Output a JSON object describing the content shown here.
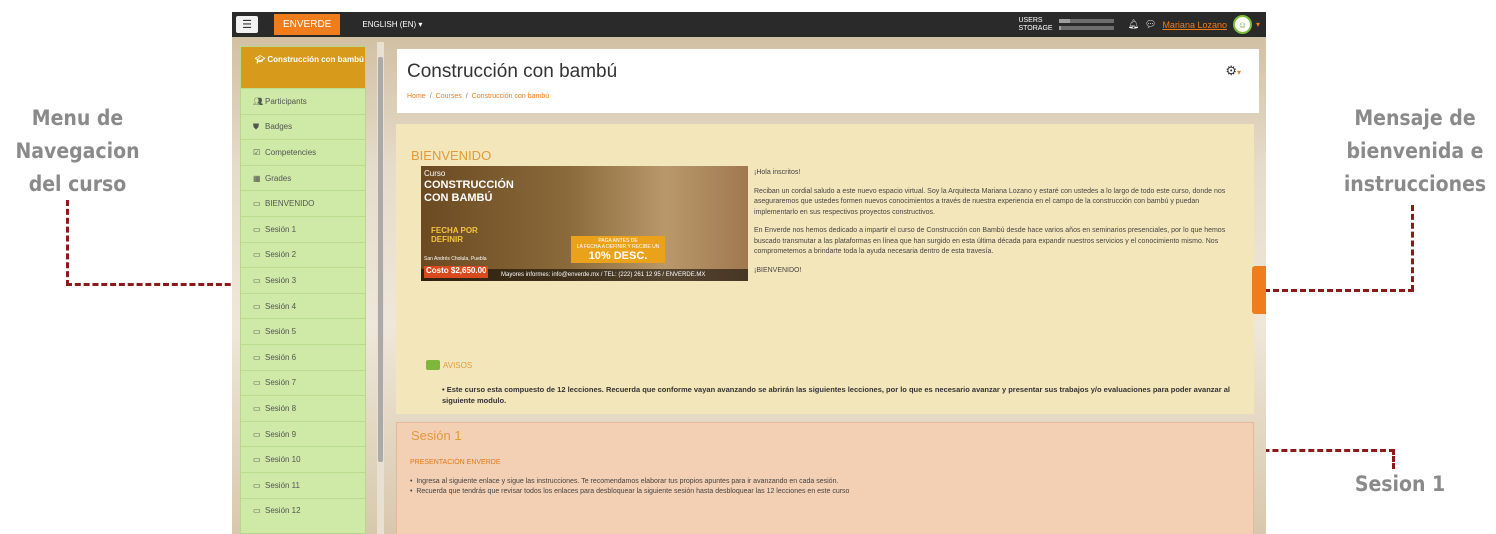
{
  "annotations": {
    "left": [
      "Menu de",
      "Navegacion",
      "del curso"
    ],
    "right": [
      "Mensaje de",
      "bienvenida e",
      "instrucciones"
    ],
    "bottom": "Sesion 1"
  },
  "navbar": {
    "brand": "ENVERDE",
    "language": "ENGLISH (EN)",
    "users_label": "USERS",
    "storage_label": "STORAGE",
    "user_name": "Mariana Lozano"
  },
  "sidebar": {
    "course": "Construcción con bambú",
    "items": [
      {
        "label": "Participants",
        "icon": "users-icon"
      },
      {
        "label": "Badges",
        "icon": "shield-icon"
      },
      {
        "label": "Competencies",
        "icon": "check-icon"
      },
      {
        "label": "Grades",
        "icon": "table-icon"
      },
      {
        "label": "BIENVENIDO",
        "icon": "folder-icon"
      },
      {
        "label": "Sesión 1",
        "icon": "folder-icon"
      },
      {
        "label": "Sesión 2",
        "icon": "folder-icon"
      },
      {
        "label": "Sesión 3",
        "icon": "folder-icon"
      },
      {
        "label": "Sesión 4",
        "icon": "folder-icon"
      },
      {
        "label": "Sesión 5",
        "icon": "folder-icon"
      },
      {
        "label": "Sesión 6",
        "icon": "folder-icon"
      },
      {
        "label": "Sesión 7",
        "icon": "folder-icon"
      },
      {
        "label": "Sesión 8",
        "icon": "folder-icon"
      },
      {
        "label": "Sesión 9",
        "icon": "folder-icon"
      },
      {
        "label": "Sesión 10",
        "icon": "folder-icon"
      },
      {
        "label": "Sesión 11",
        "icon": "folder-icon"
      },
      {
        "label": "Sesión 12",
        "icon": "folder-icon"
      }
    ]
  },
  "header": {
    "title": "Construcción con bambú",
    "breadcrumb": [
      "Home",
      "Courses",
      "Construcción con bambú"
    ]
  },
  "welcome": {
    "title": "BIENVENIDO",
    "banner": {
      "line1": "Curso",
      "line2": "CONSTRUCCIÓN",
      "line3": "CON BAMBÚ",
      "date1": "FECHA POR",
      "date2": "DEFINIR",
      "place": "San Andrés Cholula, Puebla",
      "price": "Costo $2,650.00",
      "promo1": "PAGA ANTES DE",
      "promo2": "LA FECHA A DEFINIR Y RECIBE UN",
      "promo3": "10% DESC.",
      "contact": "Mayores informes:  info@enverde.mx / TEL: (222) 261 12 95 / ENVERDE.MX"
    },
    "paragraphs": [
      "¡Hola inscritos!",
      "Reciban un cordial saludo a este nuevo espacio virtual. Soy la Arquitecta Mariana Lozano y estaré con ustedes a lo largo de todo este curso, donde nos aseguraremos que ustedes formen nuevos conocimientos a través de nuestra experiencia en el campo de la construcción con bambú y  puedan implementarlo en sus respectivos proyectos constructivos.",
      "En Enverde nos hemos dedicado a impartir el curso de Construcción con Bambú desde hace varios años en seminarios presenciales, por lo que hemos buscado transmutar a las plataformas en línea que han surgido en esta última década para expandir nuestros servicios y el conocimiento mismo. Nos comprometemos a brindarte toda la ayuda necesaria dentro de esta travesía.",
      "¡BIENVENIDO!"
    ],
    "avisos_label": "AVISOS",
    "avisos_item": "Este curso esta compuesto de 12 lecciones. Recuerda que conforme vayan avanzando se abrirán las siguientes lecciones, por lo que es necesario avanzar y presentar sus trabajos y/o evaluaciones para poder avanzar al siguiente modulo."
  },
  "session1": {
    "title": "Sesión 1",
    "subtitle": "PRESENTACIÓN ENVERDE",
    "items": [
      "Ingresa al siguiente enlace y sigue las instrucciones. Te recomendamos elaborar tus propios apuntes para ir avanzando en cada sesión.",
      "Recuerda que tendrás que revisar todos los enlaces para desbloquear la siguiente sesión hasta desbloquear las 12  lecciones en este curso"
    ]
  }
}
